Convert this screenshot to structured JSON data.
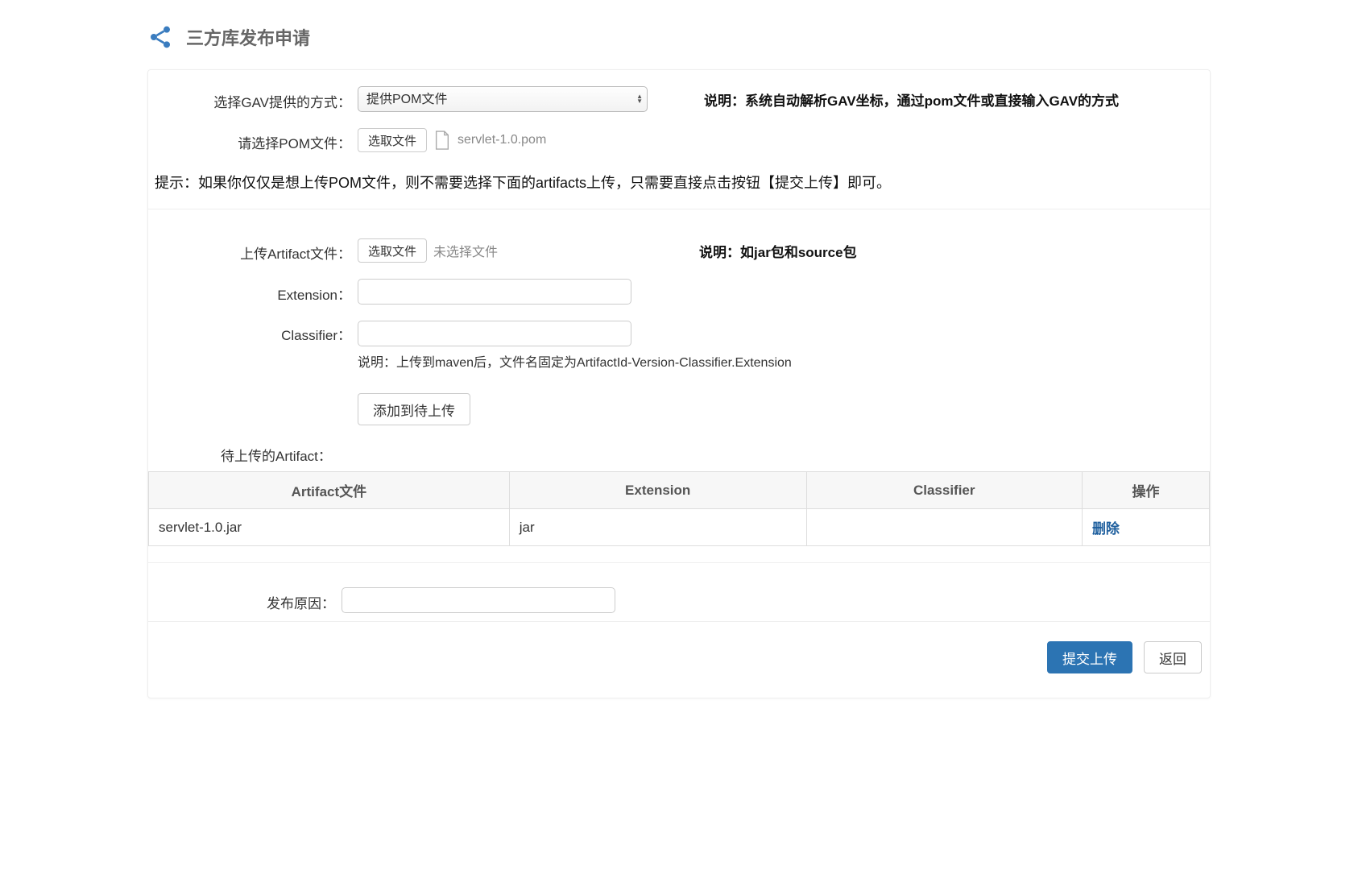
{
  "pageTitle": "三方库发布申请",
  "gavMethod": {
    "label": "选择GAV提供的方式：",
    "selected": "提供POM文件",
    "explain": "说明：系统自动解析GAV坐标，通过pom文件或直接输入GAV的方式"
  },
  "pomFile": {
    "label": "请选择POM文件：",
    "chooseBtn": "选取文件",
    "fileName": "servlet-1.0.pom"
  },
  "tip": "提示：如果你仅仅是想上传POM文件，则不需要选择下面的artifacts上传，只需要直接点击按钮【提交上传】即可。",
  "artifactUpload": {
    "label": "上传Artifact文件：",
    "chooseBtn": "选取文件",
    "noFile": "未选择文件",
    "explain": "说明：如jar包和source包"
  },
  "extension": {
    "label": "Extension：",
    "value": ""
  },
  "classifier": {
    "label": "Classifier：",
    "value": "",
    "hint": "说明：上传到maven后，文件名固定为ArtifactId-Version-Classifier.Extension"
  },
  "addPendingBtn": "添加到待上传",
  "pendingLabel": "待上传的Artifact：",
  "table": {
    "headers": {
      "file": "Artifact文件",
      "extension": "Extension",
      "classifier": "Classifier",
      "action": "操作"
    },
    "rows": [
      {
        "file": "servlet-1.0.jar",
        "extension": "jar",
        "classifier": "",
        "actionLabel": "删除"
      }
    ]
  },
  "reason": {
    "label": "发布原因：",
    "value": ""
  },
  "actions": {
    "submit": "提交上传",
    "back": "返回"
  }
}
